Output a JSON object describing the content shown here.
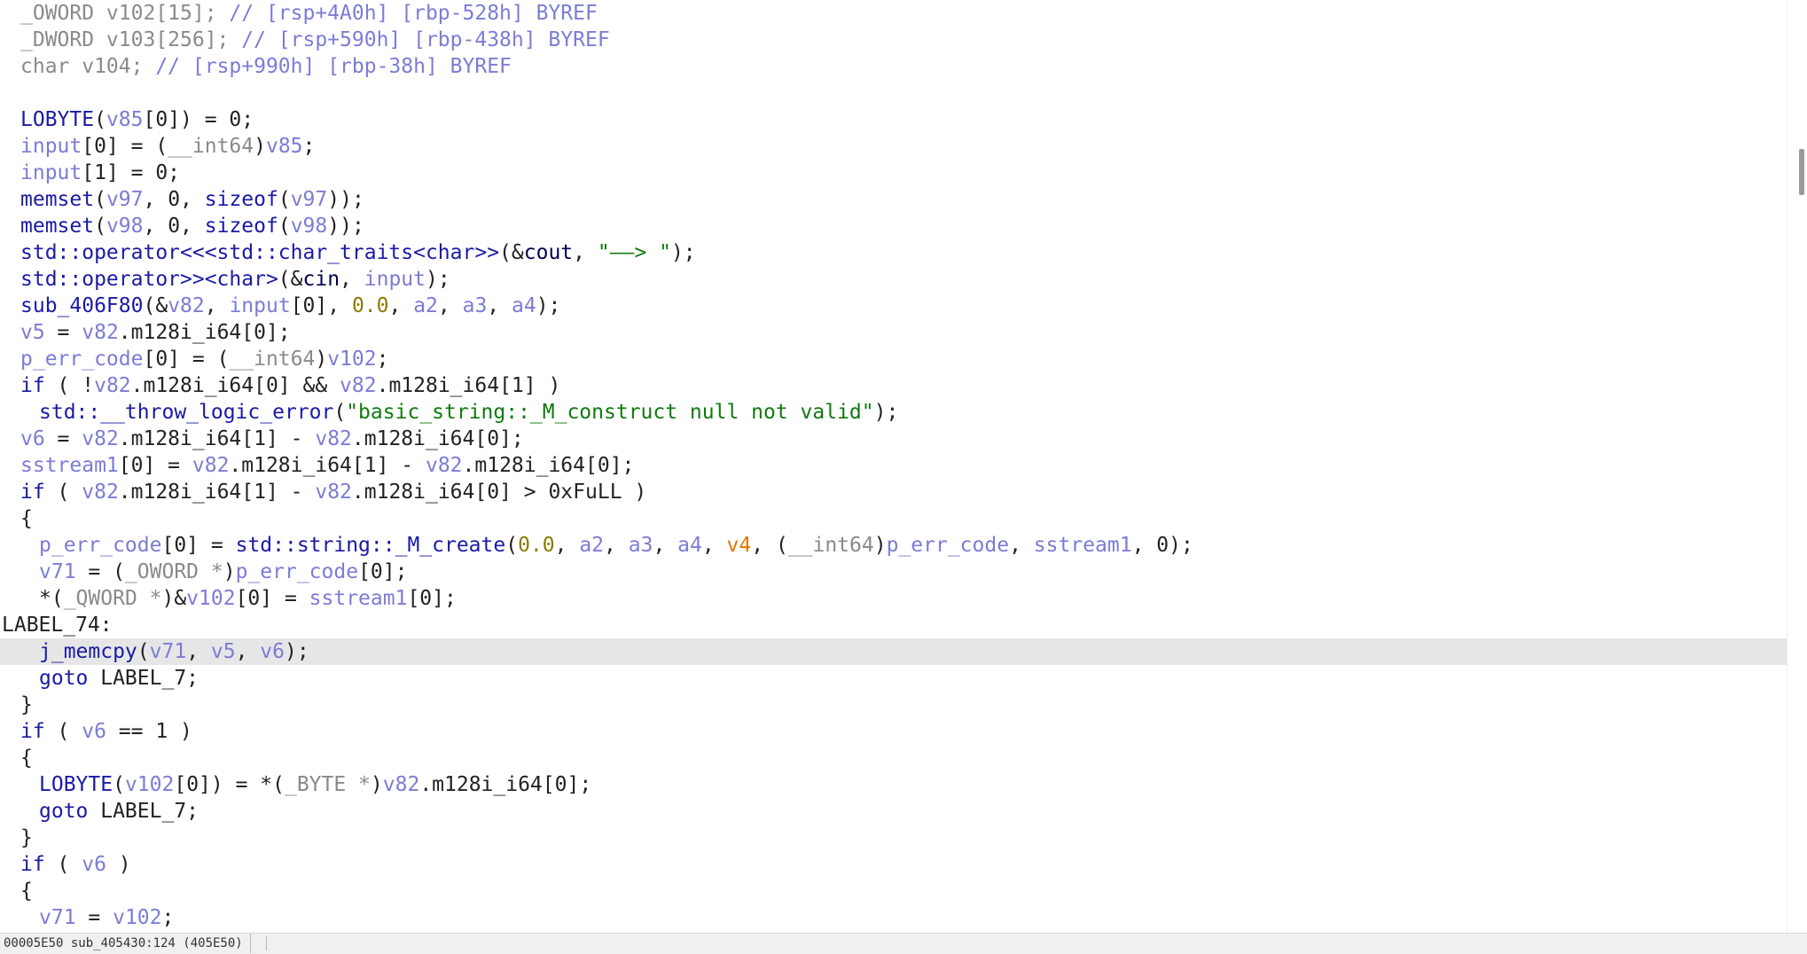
{
  "code": {
    "lines": [
      {
        "indent": 1,
        "tokens": [
          [
            "g",
            "_OWORD v102[15]; "
          ],
          [
            "c",
            "// [rsp+4A0h] [rbp-528h] BYREF"
          ]
        ]
      },
      {
        "indent": 1,
        "tokens": [
          [
            "g",
            "_DWORD v103[256]; "
          ],
          [
            "c",
            "// [rsp+590h] [rbp-438h] BYREF"
          ]
        ]
      },
      {
        "indent": 1,
        "tokens": [
          [
            "g",
            "char v104; "
          ],
          [
            "c",
            "// [rsp+990h] [rbp-38h] BYREF"
          ]
        ]
      },
      {
        "indent": 0,
        "tokens": []
      },
      {
        "indent": 1,
        "tokens": [
          [
            "f",
            "LOBYTE"
          ],
          [
            "p",
            "("
          ],
          [
            "v",
            "v85"
          ],
          [
            "p",
            "[0]) = 0;"
          ]
        ]
      },
      {
        "indent": 1,
        "tokens": [
          [
            "v",
            "input"
          ],
          [
            "p",
            "[0] = ("
          ],
          [
            "g",
            "__int64"
          ],
          [
            "p",
            ")"
          ],
          [
            "v",
            "v85"
          ],
          [
            "p",
            ";"
          ]
        ]
      },
      {
        "indent": 1,
        "tokens": [
          [
            "v",
            "input"
          ],
          [
            "p",
            "[1] = 0;"
          ]
        ]
      },
      {
        "indent": 1,
        "tokens": [
          [
            "f",
            "memset"
          ],
          [
            "p",
            "("
          ],
          [
            "v",
            "v97"
          ],
          [
            "p",
            ", 0, "
          ],
          [
            "k",
            "sizeof"
          ],
          [
            "p",
            "("
          ],
          [
            "v",
            "v97"
          ],
          [
            "p",
            "));"
          ]
        ]
      },
      {
        "indent": 1,
        "tokens": [
          [
            "f",
            "memset"
          ],
          [
            "p",
            "("
          ],
          [
            "v",
            "v98"
          ],
          [
            "p",
            ", 0, "
          ],
          [
            "k",
            "sizeof"
          ],
          [
            "p",
            "("
          ],
          [
            "v",
            "v98"
          ],
          [
            "p",
            "));"
          ]
        ]
      },
      {
        "indent": 1,
        "tokens": [
          [
            "f",
            "std::operator<<<std::char_traits<char>>"
          ],
          [
            "p",
            "(&"
          ],
          [
            "l",
            "cout"
          ],
          [
            "p",
            ", "
          ],
          [
            "s",
            "\"——> \""
          ],
          [
            "p",
            ");"
          ]
        ]
      },
      {
        "indent": 1,
        "tokens": [
          [
            "f",
            "std::operator>><char>"
          ],
          [
            "p",
            "(&"
          ],
          [
            "l",
            "cin"
          ],
          [
            "p",
            ", "
          ],
          [
            "v",
            "input"
          ],
          [
            "p",
            ");"
          ]
        ]
      },
      {
        "indent": 1,
        "tokens": [
          [
            "f",
            "sub_406F80"
          ],
          [
            "p",
            "(&"
          ],
          [
            "v",
            "v82"
          ],
          [
            "p",
            ", "
          ],
          [
            "v",
            "input"
          ],
          [
            "p",
            "[0], "
          ],
          [
            "n",
            "0.0"
          ],
          [
            "p",
            ", "
          ],
          [
            "v",
            "a2"
          ],
          [
            "p",
            ", "
          ],
          [
            "v",
            "a3"
          ],
          [
            "p",
            ", "
          ],
          [
            "v",
            "a4"
          ],
          [
            "p",
            ");"
          ]
        ]
      },
      {
        "indent": 1,
        "tokens": [
          [
            "v",
            "v5"
          ],
          [
            "p",
            " = "
          ],
          [
            "v",
            "v82"
          ],
          [
            "p",
            ".m128i_i64[0];"
          ]
        ]
      },
      {
        "indent": 1,
        "tokens": [
          [
            "v",
            "p_err_code"
          ],
          [
            "p",
            "[0] = ("
          ],
          [
            "g",
            "__int64"
          ],
          [
            "p",
            ")"
          ],
          [
            "v",
            "v102"
          ],
          [
            "p",
            ";"
          ]
        ]
      },
      {
        "indent": 1,
        "tokens": [
          [
            "k",
            "if"
          ],
          [
            "p",
            " ( !"
          ],
          [
            "v",
            "v82"
          ],
          [
            "p",
            ".m128i_i64[0] && "
          ],
          [
            "v",
            "v82"
          ],
          [
            "p",
            ".m128i_i64[1] )"
          ]
        ]
      },
      {
        "indent": 2,
        "tokens": [
          [
            "f",
            "std::__throw_logic_error"
          ],
          [
            "p",
            "("
          ],
          [
            "s",
            "\"basic_string::_M_construct null not valid\""
          ],
          [
            "p",
            ");"
          ]
        ]
      },
      {
        "indent": 1,
        "tokens": [
          [
            "v",
            "v6"
          ],
          [
            "p",
            " = "
          ],
          [
            "v",
            "v82"
          ],
          [
            "p",
            ".m128i_i64[1] - "
          ],
          [
            "v",
            "v82"
          ],
          [
            "p",
            ".m128i_i64[0];"
          ]
        ]
      },
      {
        "indent": 1,
        "tokens": [
          [
            "v",
            "sstream1"
          ],
          [
            "p",
            "[0] = "
          ],
          [
            "v",
            "v82"
          ],
          [
            "p",
            ".m128i_i64[1] - "
          ],
          [
            "v",
            "v82"
          ],
          [
            "p",
            ".m128i_i64[0];"
          ]
        ]
      },
      {
        "indent": 1,
        "tokens": [
          [
            "k",
            "if"
          ],
          [
            "p",
            " ( "
          ],
          [
            "v",
            "v82"
          ],
          [
            "p",
            ".m128i_i64[1] - "
          ],
          [
            "v",
            "v82"
          ],
          [
            "p",
            ".m128i_i64[0] > 0xFuLL )"
          ]
        ]
      },
      {
        "indent": 1,
        "tokens": [
          [
            "p",
            "{"
          ]
        ]
      },
      {
        "indent": 2,
        "tokens": [
          [
            "v",
            "p_err_code"
          ],
          [
            "p",
            "[0] = "
          ],
          [
            "f",
            "std::string::_M_create"
          ],
          [
            "p",
            "("
          ],
          [
            "n",
            "0.0"
          ],
          [
            "p",
            ", "
          ],
          [
            "v",
            "a2"
          ],
          [
            "p",
            ", "
          ],
          [
            "v",
            "a3"
          ],
          [
            "p",
            ", "
          ],
          [
            "v",
            "a4"
          ],
          [
            "p",
            ", "
          ],
          [
            "o",
            "v4"
          ],
          [
            "p",
            ", ("
          ],
          [
            "g",
            "__int64"
          ],
          [
            "p",
            ")"
          ],
          [
            "v",
            "p_err_code"
          ],
          [
            "p",
            ", "
          ],
          [
            "v",
            "sstream1"
          ],
          [
            "p",
            ", 0);"
          ]
        ]
      },
      {
        "indent": 2,
        "tokens": [
          [
            "v",
            "v71"
          ],
          [
            "p",
            " = ("
          ],
          [
            "g",
            "_OWORD *"
          ],
          [
            "p",
            ")"
          ],
          [
            "v",
            "p_err_code"
          ],
          [
            "p",
            "[0];"
          ]
        ]
      },
      {
        "indent": 2,
        "tokens": [
          [
            "p",
            "*("
          ],
          [
            "g",
            "_QWORD *"
          ],
          [
            "p",
            ")&"
          ],
          [
            "v",
            "v102"
          ],
          [
            "p",
            "[0] = "
          ],
          [
            "v",
            "sstream1"
          ],
          [
            "p",
            "[0];"
          ]
        ]
      },
      {
        "indent": 0,
        "tokens": [
          [
            "p",
            "LABEL_74:"
          ]
        ]
      },
      {
        "indent": 2,
        "highlighted": true,
        "tokens": [
          [
            "f",
            "j_memcpy"
          ],
          [
            "p",
            "("
          ],
          [
            "v",
            "v71"
          ],
          [
            "p",
            ", "
          ],
          [
            "v",
            "v5"
          ],
          [
            "p",
            ", "
          ],
          [
            "v",
            "v6"
          ],
          [
            "p",
            ");"
          ]
        ]
      },
      {
        "indent": 2,
        "tokens": [
          [
            "k",
            "goto"
          ],
          [
            "p",
            " LABEL_7;"
          ]
        ]
      },
      {
        "indent": 1,
        "tokens": [
          [
            "p",
            "}"
          ]
        ]
      },
      {
        "indent": 1,
        "tokens": [
          [
            "k",
            "if"
          ],
          [
            "p",
            " ( "
          ],
          [
            "v",
            "v6"
          ],
          [
            "p",
            " == 1 )"
          ]
        ]
      },
      {
        "indent": 1,
        "tokens": [
          [
            "p",
            "{"
          ]
        ]
      },
      {
        "indent": 2,
        "tokens": [
          [
            "f",
            "LOBYTE"
          ],
          [
            "p",
            "("
          ],
          [
            "v",
            "v102"
          ],
          [
            "p",
            "[0]) = *("
          ],
          [
            "g",
            "_BYTE *"
          ],
          [
            "p",
            ")"
          ],
          [
            "v",
            "v82"
          ],
          [
            "p",
            ".m128i_i64[0];"
          ]
        ]
      },
      {
        "indent": 2,
        "tokens": [
          [
            "k",
            "goto"
          ],
          [
            "p",
            " LABEL_7;"
          ]
        ]
      },
      {
        "indent": 1,
        "tokens": [
          [
            "p",
            "}"
          ]
        ]
      },
      {
        "indent": 1,
        "tokens": [
          [
            "k",
            "if"
          ],
          [
            "p",
            " ( "
          ],
          [
            "v",
            "v6"
          ],
          [
            "p",
            " )"
          ]
        ]
      },
      {
        "indent": 1,
        "tokens": [
          [
            "p",
            "{"
          ]
        ]
      },
      {
        "indent": 2,
        "tokens": [
          [
            "v",
            "v71"
          ],
          [
            "p",
            " = "
          ],
          [
            "v",
            "v102"
          ],
          [
            "p",
            ";"
          ]
        ]
      }
    ]
  },
  "status_bar": {
    "location": "00005E50 sub_405430:124 (405E50)"
  },
  "colors": {
    "variable": "#7c7cd6",
    "function": "#1a1aa6",
    "string": "#0f7a0f",
    "number": "#8a7a00",
    "argument_highlight": "#e07800",
    "type_gray": "#8a8a8a",
    "line_highlight": "#e6e6e6"
  }
}
